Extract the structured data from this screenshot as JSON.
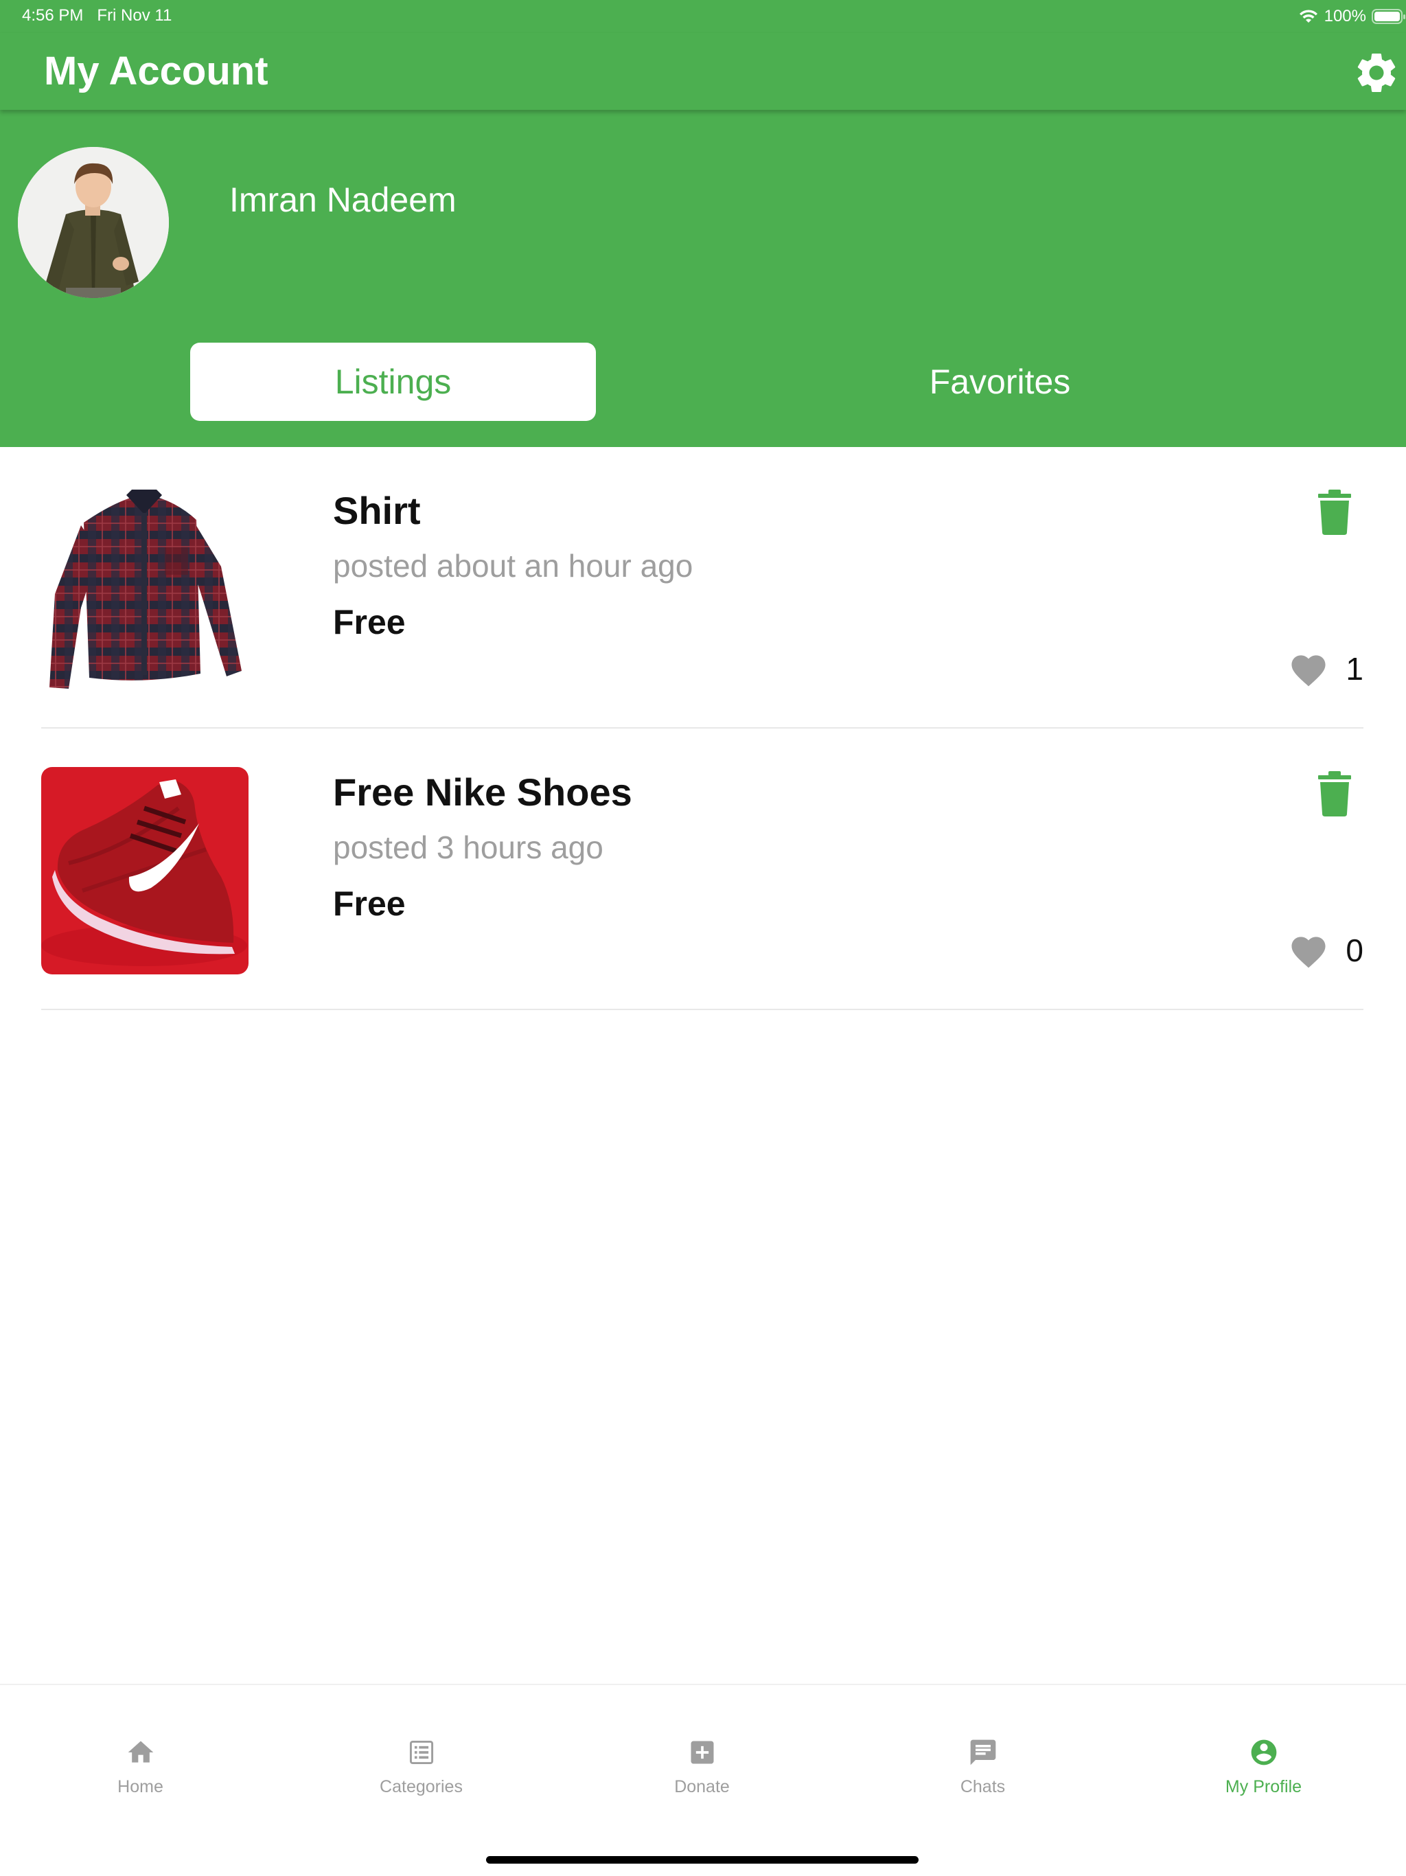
{
  "status_bar": {
    "time": "4:56 PM",
    "date": "Fri Nov 11",
    "battery": "100%",
    "icons": [
      "wifi-icon",
      "battery-icon"
    ]
  },
  "header": {
    "title": "My Account",
    "settings_icon": "gear-icon"
  },
  "profile": {
    "name": "Imran Nadeem"
  },
  "tabs": [
    {
      "label": "Listings",
      "active": true
    },
    {
      "label": "Favorites",
      "active": false
    }
  ],
  "listings": [
    {
      "title": "Shirt",
      "posted": "posted about an hour ago",
      "price": "Free",
      "likes": "1",
      "image": "plaid-shirt"
    },
    {
      "title": "Free Nike Shoes",
      "posted": "posted 3 hours ago",
      "price": "Free",
      "likes": "0",
      "image": "red-sneaker"
    }
  ],
  "bottom_nav": [
    {
      "label": "Home",
      "icon": "home-icon",
      "active": false
    },
    {
      "label": "Categories",
      "icon": "categories-icon",
      "active": false
    },
    {
      "label": "Donate",
      "icon": "donate-plus-icon",
      "active": false
    },
    {
      "label": "Chats",
      "icon": "chat-icon",
      "active": false
    },
    {
      "label": "My Profile",
      "icon": "profile-icon",
      "active": true
    }
  ],
  "colors": {
    "primary_green": "#4caf50",
    "inactive_gray": "#9e9e9e",
    "text_dark": "#111111"
  }
}
